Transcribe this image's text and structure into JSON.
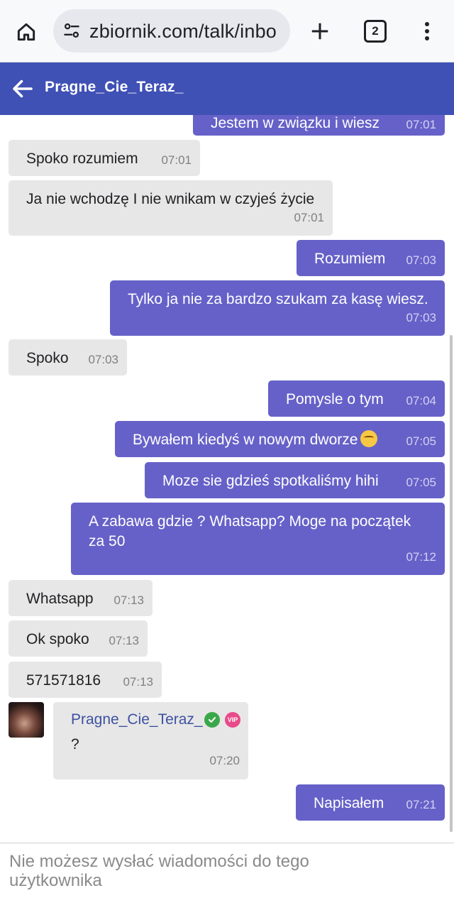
{
  "browser": {
    "url": "zbiornik.com/talk/inbo",
    "tab_count": "2"
  },
  "chat": {
    "title": "Pragne_Cie_Teraz_"
  },
  "messages": [
    {
      "dir": "out",
      "text": "Jestem w związku i wiesz",
      "time": "07:01"
    },
    {
      "dir": "in",
      "text": "Spoko rozumiem",
      "time": "07:01"
    },
    {
      "dir": "in",
      "text": "Ja nie wchodzę I nie wnikam w czyjeś życie",
      "time": "07:01"
    },
    {
      "dir": "out",
      "text": "Rozumiem",
      "time": "07:03"
    },
    {
      "dir": "out",
      "text": "Tylko ja nie za bardzo szukam za kasę wiesz.",
      "time": "07:03"
    },
    {
      "dir": "in",
      "text": "Spoko",
      "time": "07:03"
    },
    {
      "dir": "out",
      "text": "Pomysle o tym",
      "time": "07:04"
    },
    {
      "dir": "out",
      "text": "Bywałem kiedyś w nowym dworze",
      "time": "07:05"
    },
    {
      "dir": "out",
      "text": "Moze sie gdzieś spotkaliśmy hihi",
      "time": "07:05"
    },
    {
      "dir": "out",
      "text": "A zabawa gdzie ? Whatsapp? Moge na początek za 50",
      "time": "07:12"
    },
    {
      "dir": "in",
      "text": "Whatsapp",
      "time": "07:13"
    },
    {
      "dir": "in",
      "text": "Ok spoko",
      "time": "07:13"
    },
    {
      "dir": "in",
      "text": "571571816",
      "time": "07:13"
    },
    {
      "dir": "in",
      "text": "?",
      "time": "07:20"
    },
    {
      "dir": "out",
      "text": "Napisałem",
      "time": "07:21"
    }
  ],
  "user_card": {
    "name": "Pragne_Cie_Teraz_",
    "vip_badge": "VIP"
  },
  "footer": {
    "notice": "Nie możesz wysłać wiadomości do tego użytkownika"
  },
  "colors": {
    "header": "#3f51b5",
    "outgoing_bubble": "#6661c8",
    "incoming_bubble": "#e7e7e7"
  }
}
